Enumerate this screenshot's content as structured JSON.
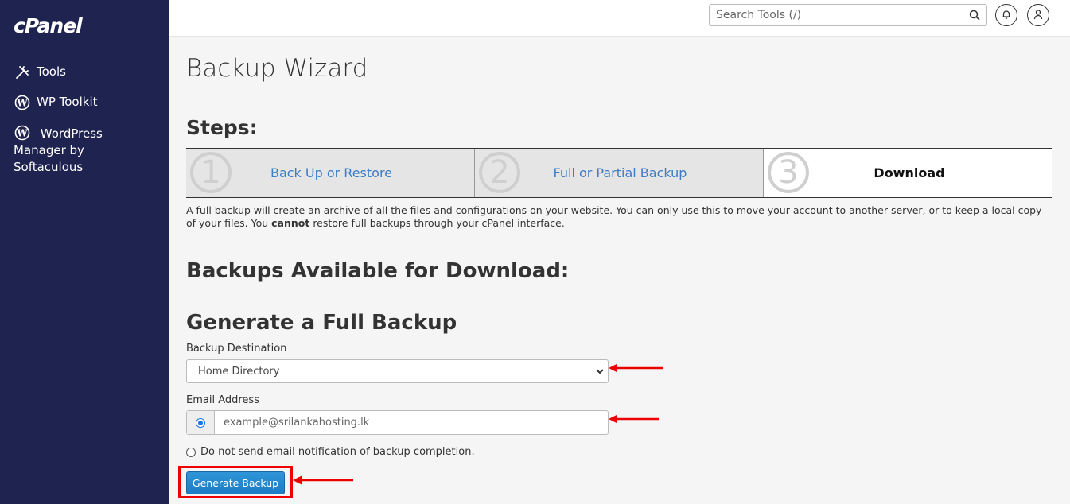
{
  "sidebar": {
    "logo": "cPanel",
    "items": [
      {
        "label": "Tools",
        "icon": "tools-icon"
      },
      {
        "label": "WP Toolkit",
        "icon": "wordpress-icon"
      },
      {
        "label": "WordPress Manager by Softaculous",
        "icon": "wordpress-icon"
      }
    ]
  },
  "topbar": {
    "search_placeholder": "Search Tools (/)",
    "icons": [
      "bell-icon",
      "user-icon"
    ]
  },
  "page": {
    "title": "Backup Wizard",
    "steps_title": "Steps:",
    "steps": [
      {
        "number": "1",
        "label": "Back Up or Restore",
        "active": false
      },
      {
        "number": "2",
        "label": "Full or Partial Backup",
        "active": false
      },
      {
        "number": "3",
        "label": "Download",
        "active": true
      }
    ],
    "description_part1": "A full backup will create an archive of all the files and configurations on your website. You can only use this to move your account to another server, or to keep a local copy of your files. You ",
    "description_bold": "cannot",
    "description_part2": " restore full backups through your cPanel interface.",
    "available_heading": "Backups Available for Download:",
    "generate_heading": "Generate a Full Backup",
    "destination_label": "Backup Destination",
    "destination_value": "Home Directory",
    "email_label": "Email Address",
    "email_placeholder": "example@srilankahosting.lk",
    "no_email_label": "Do not send email notification of backup completion.",
    "generate_button": "Generate Backup"
  },
  "colors": {
    "sidebar_bg": "#1f2350",
    "link": "#3b7dc6",
    "button": "#1c7cc4",
    "annotation": "#e00000"
  }
}
